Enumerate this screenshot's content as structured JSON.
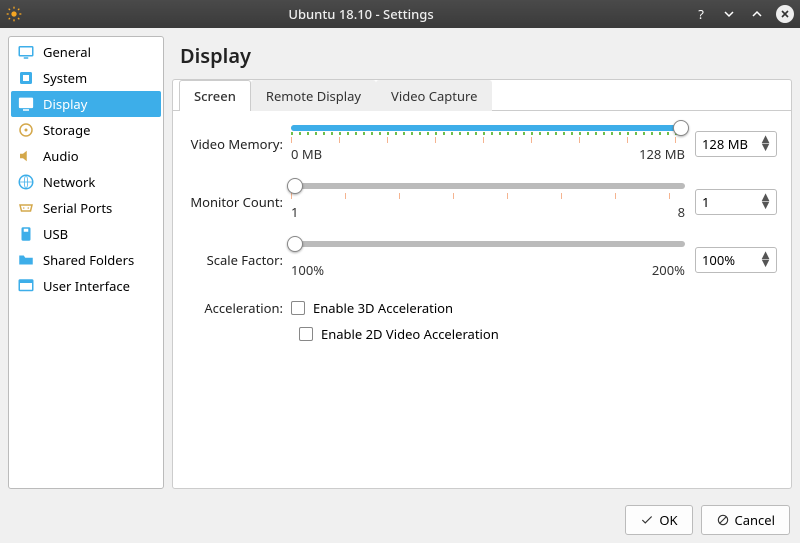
{
  "titlebar": {
    "title": "Ubuntu 18.10 - Settings"
  },
  "sidebar": {
    "items": [
      {
        "label": "General"
      },
      {
        "label": "System"
      },
      {
        "label": "Display"
      },
      {
        "label": "Storage"
      },
      {
        "label": "Audio"
      },
      {
        "label": "Network"
      },
      {
        "label": "Serial Ports"
      },
      {
        "label": "USB"
      },
      {
        "label": "Shared Folders"
      },
      {
        "label": "User Interface"
      }
    ],
    "selected_index": 2
  },
  "page": {
    "title": "Display",
    "tabs": [
      {
        "label": "Screen"
      },
      {
        "label": "Remote Display"
      },
      {
        "label": "Video Capture"
      }
    ],
    "active_tab": 0,
    "video_memory": {
      "label": "Video Memory:",
      "min_label": "0 MB",
      "max_label": "128 MB",
      "value": "128 MB",
      "fill_pct": 99
    },
    "monitor_count": {
      "label": "Monitor Count:",
      "min_label": "1",
      "max_label": "8",
      "value": "1",
      "fill_pct": 1
    },
    "scale_factor": {
      "label": "Scale Factor:",
      "min_label": "100%",
      "max_label": "200%",
      "value": "100%",
      "fill_pct": 1
    },
    "acceleration": {
      "label": "Acceleration:",
      "enable_3d": "Enable 3D Acceleration",
      "enable_2d": "Enable 2D Video Acceleration"
    }
  },
  "footer": {
    "ok": "OK",
    "cancel": "Cancel"
  }
}
